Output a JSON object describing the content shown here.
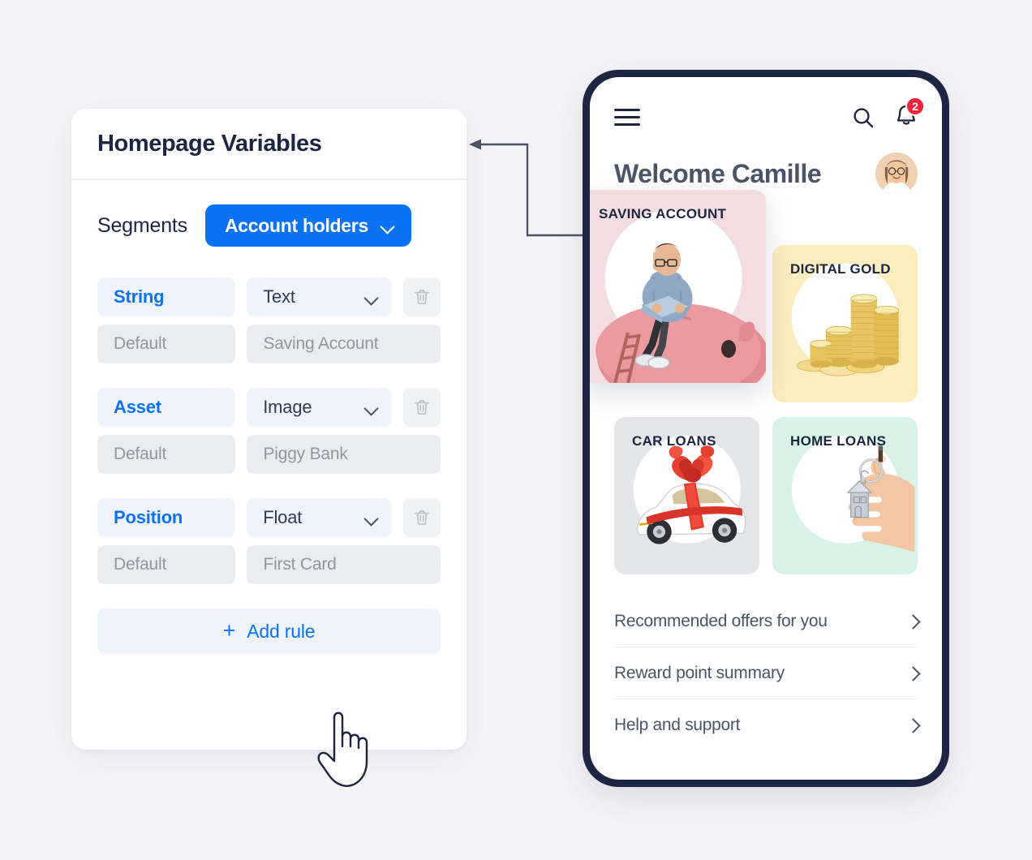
{
  "panel": {
    "title": "Homepage Variables",
    "segments": {
      "label": "Segments",
      "selected": "Account holders"
    },
    "rules": [
      {
        "name": "String",
        "type": "Text",
        "default_placeholder": "Default",
        "value_placeholder": "Saving Account",
        "delete_label": "Delete rule"
      },
      {
        "name": "Asset",
        "type": "Image",
        "default_placeholder": "Default",
        "value_placeholder": "Piggy Bank",
        "delete_label": "Delete rule"
      },
      {
        "name": "Position",
        "type": "Float",
        "default_placeholder": "Default",
        "value_placeholder": "First Card",
        "delete_label": "Delete rule"
      }
    ],
    "add_rule": {
      "plus": "+",
      "label": "Add rule"
    }
  },
  "phone": {
    "topbar": {
      "menu_icon": "hamburger-icon",
      "search_icon": "search-icon",
      "bell_icon": "bell-icon",
      "notification_count": "2"
    },
    "welcome": "Welcome Camille",
    "avatar_alt": "user-avatar",
    "cards": [
      {
        "label": "SAVING ACCOUNT",
        "art": "piggy-bank",
        "bg": "#f3dde0"
      },
      {
        "label": "DIGITAL GOLD",
        "art": "gold-coins",
        "bg": "#fcedbf"
      },
      {
        "label": "CAR LOANS",
        "art": "car-with-bow",
        "bg": "#e4e6ea"
      },
      {
        "label": "HOME LOANS",
        "art": "house-key",
        "bg": "#d8f2e7"
      }
    ],
    "list": [
      "Recommended offers for you",
      "Reward point summary",
      "Help and support"
    ]
  },
  "colors": {
    "accent": "#0a72f5",
    "dark": "#1c2541",
    "badge": "#f5233b",
    "page_bg": "#f5f5f7",
    "pill_blue_bg": "#eef3fe",
    "pill_grey_bg": "#ebecef"
  }
}
